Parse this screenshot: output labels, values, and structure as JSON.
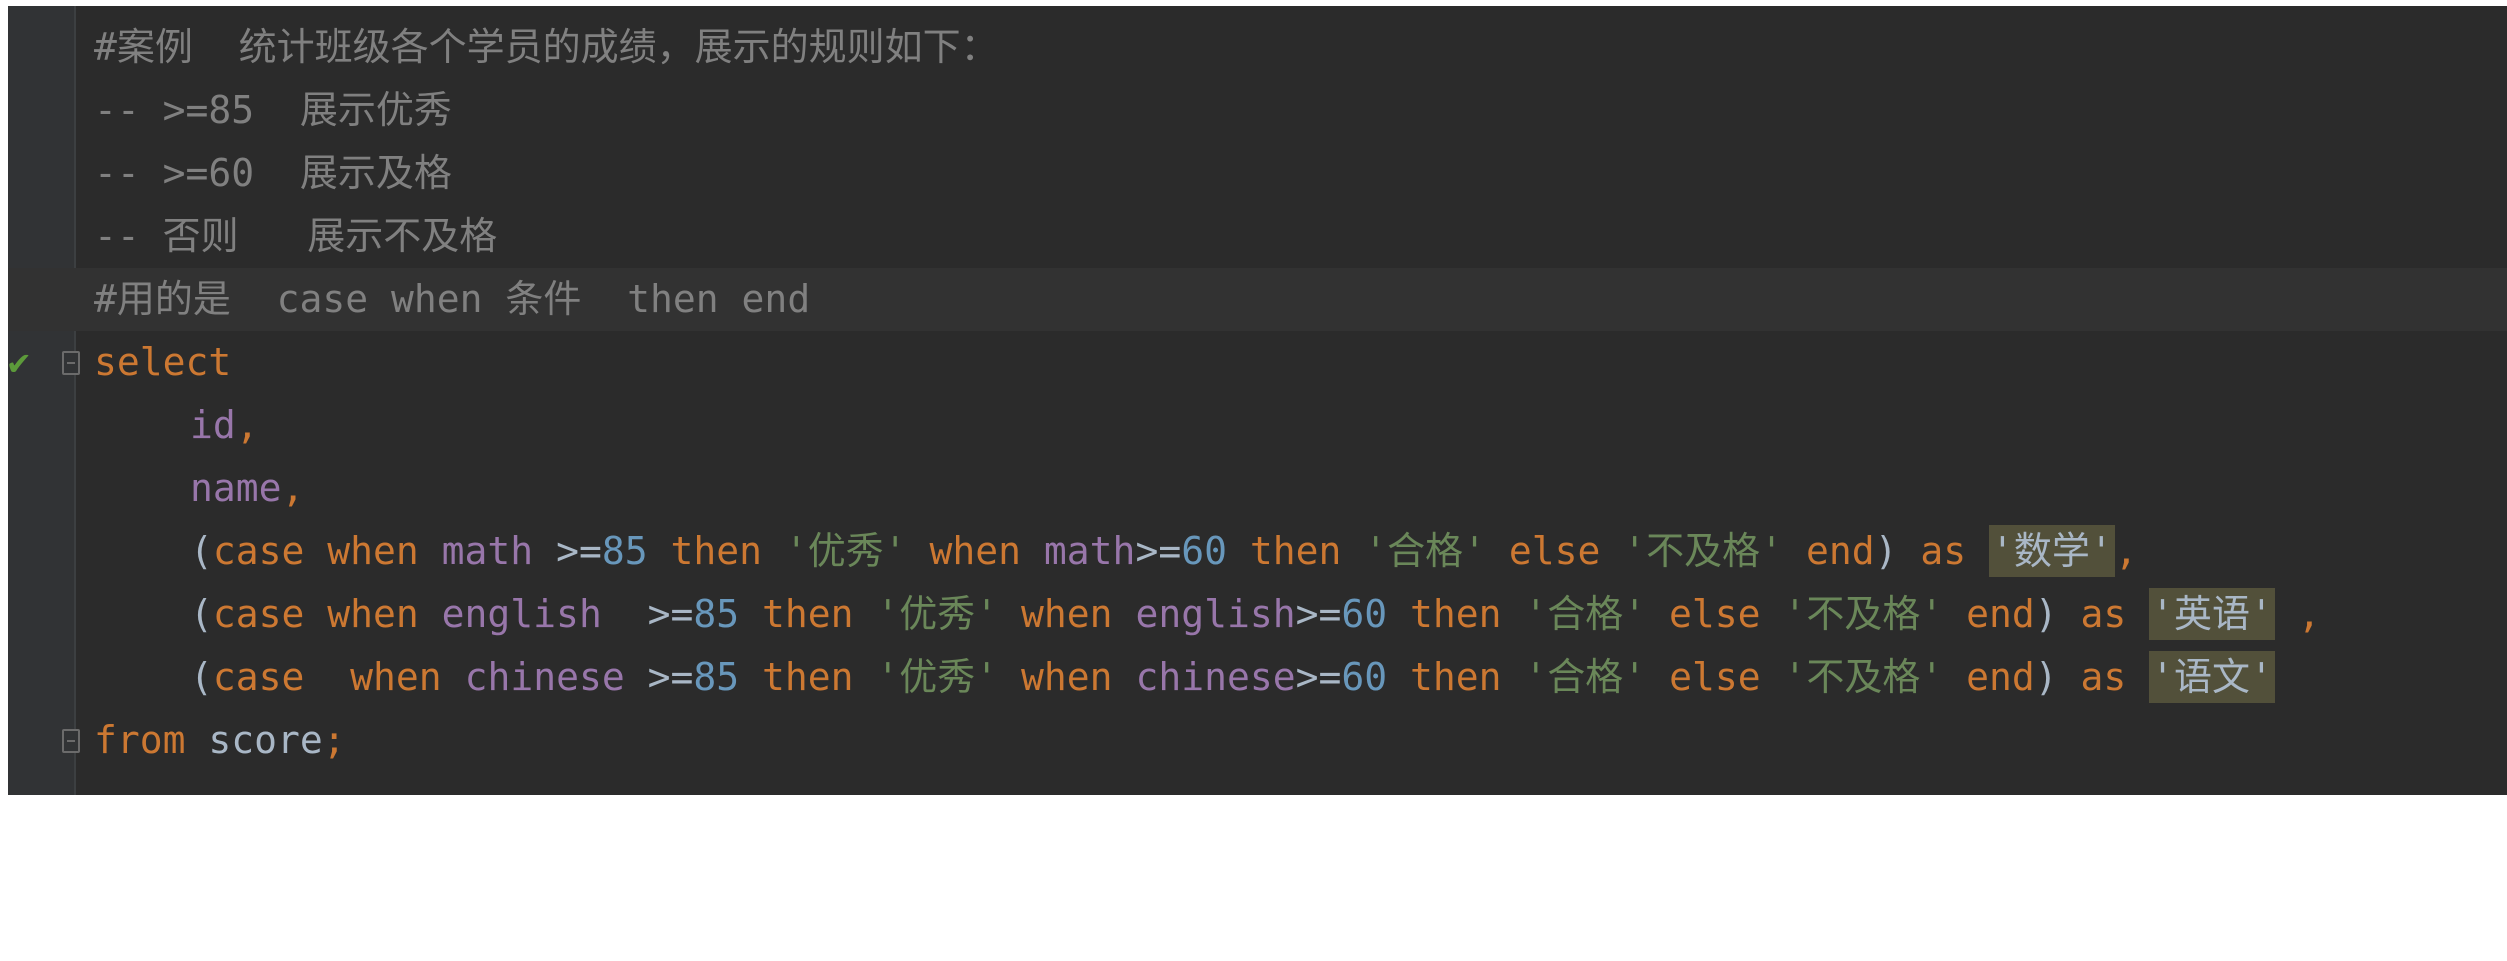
{
  "editor": {
    "lines": [
      {
        "text": "#案例  统计班级各个学员的成绩，展示的规则如下："
      },
      {
        "text": "-- >=85  展示优秀"
      },
      {
        "text": "-- >=60  展示及格"
      },
      {
        "text": "-- 否则   展示不及格"
      },
      {
        "text": "#用的是  case when 条件  then end"
      },
      {
        "keyword": "select"
      },
      {
        "ident": "id",
        "punct": ","
      },
      {
        "ident": "name",
        "punct": ","
      },
      {
        "open": "(",
        "case_kw": "case ",
        "when_kw": "when ",
        "col1": "math",
        "op1": " >=",
        "n1": "85",
        "then1": " then ",
        "s1": "'优秀'",
        "when2": " when ",
        "col2": "math",
        "op2": ">=",
        "n2": "60",
        "then2": " then ",
        "s2": "'合格'",
        "else_kw": " else ",
        "s3": "'不及格'",
        "end_kw": " end",
        "close": ")",
        "as_kw": " as ",
        "alias": "'数学'",
        "tail": ","
      },
      {
        "open": "(",
        "case_kw": "case ",
        "when_kw": "when ",
        "col1": "english",
        "op1": "  >=",
        "n1": "85",
        "then1": " then ",
        "s1": "'优秀'",
        "when2": " when ",
        "col2": "english",
        "op2": ">=",
        "n2": "60",
        "then2": " then ",
        "s2": "'合格'",
        "else_kw": " else ",
        "s3": "'不及格'",
        "end_kw": " end",
        "close": ")",
        "as_kw": " as ",
        "alias": "'英语'",
        "tail": " ,"
      },
      {
        "open": "(",
        "case_kw": "case  ",
        "when_kw": "when ",
        "col1": "chinese",
        "op1": " >=",
        "n1": "85",
        "then1": " then ",
        "s1": "'优秀'",
        "when2": " when ",
        "col2": "chinese",
        "op2": ">=",
        "n2": "60",
        "then2": " then ",
        "s2": "'合格'",
        "else_kw": " else ",
        "s3": "'不及格'",
        "end_kw": " end",
        "close": ")",
        "as_kw": " as ",
        "alias": "'语文'",
        "tail": ""
      },
      {
        "from_kw": "from",
        "table": " score",
        "semi": ";"
      }
    ],
    "gutter": {
      "run_marker_icon": "checkmark-icon",
      "fold_icon": "fold-marker-icon"
    },
    "colors": {
      "background": "#2b2b2b",
      "keyword": "#cc7832",
      "identifier": "#9876aa",
      "number": "#6897bb",
      "string": "#6a8759",
      "comment": "#808080",
      "highlight": "#52503a"
    }
  }
}
